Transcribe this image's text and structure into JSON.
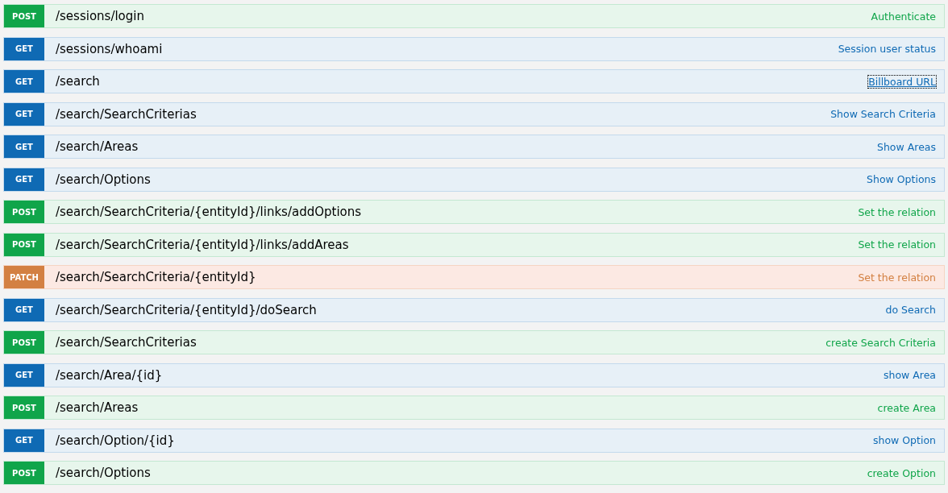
{
  "operations": [
    {
      "method": "POST",
      "path": "/sessions/login",
      "summary": "Authenticate",
      "focused": false
    },
    {
      "method": "GET",
      "path": "/sessions/whoami",
      "summary": "Session user status",
      "focused": false
    },
    {
      "method": "GET",
      "path": "/search",
      "summary": "Billboard URL",
      "focused": true
    },
    {
      "method": "GET",
      "path": "/search/SearchCriterias",
      "summary": "Show Search Criteria",
      "focused": false
    },
    {
      "method": "GET",
      "path": "/search/Areas",
      "summary": "Show Areas",
      "focused": false
    },
    {
      "method": "GET",
      "path": "/search/Options",
      "summary": "Show Options",
      "focused": false
    },
    {
      "method": "POST",
      "path": "/search/SearchCriteria/{entityId}/links/addOptions",
      "summary": "Set the relation",
      "focused": false
    },
    {
      "method": "POST",
      "path": "/search/SearchCriteria/{entityId}/links/addAreas",
      "summary": "Set the relation",
      "focused": false
    },
    {
      "method": "PATCH",
      "path": "/search/SearchCriteria/{entityId}",
      "summary": "Set the relation",
      "focused": false
    },
    {
      "method": "GET",
      "path": "/search/SearchCriteria/{entityId}/doSearch",
      "summary": "do Search",
      "focused": false
    },
    {
      "method": "POST",
      "path": "/search/SearchCriterias",
      "summary": "create Search Criteria",
      "focused": false
    },
    {
      "method": "GET",
      "path": "/search/Area/{id}",
      "summary": "show Area",
      "focused": false
    },
    {
      "method": "POST",
      "path": "/search/Areas",
      "summary": "create Area",
      "focused": false
    },
    {
      "method": "GET",
      "path": "/search/Option/{id}",
      "summary": "show Option",
      "focused": false
    },
    {
      "method": "POST",
      "path": "/search/Options",
      "summary": "create Option",
      "focused": false
    }
  ]
}
